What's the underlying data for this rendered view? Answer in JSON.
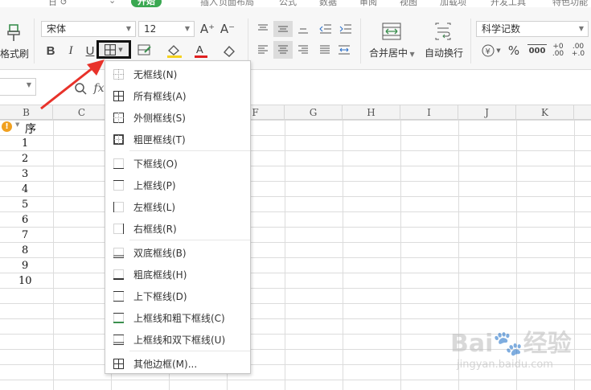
{
  "ribbon_tabs": [
    {
      "label": "开始",
      "active": true
    },
    {
      "label": "插入"
    },
    {
      "label": "页面布局"
    },
    {
      "label": "公式"
    },
    {
      "label": "数据"
    },
    {
      "label": "审阅"
    },
    {
      "label": "视图"
    },
    {
      "label": "加载项"
    },
    {
      "label": "开发工具"
    },
    {
      "label": "特色功能"
    }
  ],
  "toolbar": {
    "format_painter_label": "格式刷",
    "font_name": "宋体",
    "font_size": "12",
    "increase_font": "A⁺",
    "decrease_font": "A⁻",
    "bold": "B",
    "italic": "I",
    "underline": "U",
    "merge_center_label": "合并居中",
    "wrap_text_label": "自动换行",
    "number_format": "科学记数",
    "percent": "%",
    "thousands": "000",
    "inc_decimal": "+0 .00",
    "dec_decimal": ".00 +.0",
    "font_color": "#e02020",
    "fill_color": "#f5d21f"
  },
  "formula_bar": {
    "fx_label": "fx"
  },
  "columns": [
    "B",
    "C",
    "D",
    "E",
    "F",
    "G",
    "H",
    "I",
    "J",
    "K"
  ],
  "sheet": {
    "header_cell": "序",
    "rows": [
      "1",
      "2",
      "3",
      "4",
      "5",
      "6",
      "7",
      "8",
      "9",
      "10"
    ]
  },
  "border_menu": {
    "items": [
      {
        "label": "无框线(N)",
        "icon": "no-border-icon"
      },
      {
        "label": "所有框线(A)",
        "icon": "all-borders-icon"
      },
      {
        "label": "外侧框线(S)",
        "icon": "outside-borders-icon"
      },
      {
        "label": "粗匣框线(T)",
        "icon": "thick-box-border-icon"
      },
      {
        "label": "下框线(O)",
        "icon": "bottom-border-icon"
      },
      {
        "label": "上框线(P)",
        "icon": "top-border-icon"
      },
      {
        "label": "左框线(L)",
        "icon": "left-border-icon"
      },
      {
        "label": "右框线(R)",
        "icon": "right-border-icon"
      },
      {
        "label": "双底框线(B)",
        "icon": "double-bottom-border-icon"
      },
      {
        "label": "粗底框线(H)",
        "icon": "thick-bottom-border-icon"
      },
      {
        "label": "上下框线(D)",
        "icon": "top-bottom-border-icon"
      },
      {
        "label": "上框线和粗下框线(C)",
        "icon": "top-thick-bottom-border-icon"
      },
      {
        "label": "上框线和双下框线(U)",
        "icon": "top-double-bottom-border-icon"
      },
      {
        "label": "其他边框(M)...",
        "icon": "more-borders-icon"
      }
    ]
  },
  "watermark": {
    "text": "Bai🐾经验",
    "sub": "jingyan.baidu.com"
  }
}
